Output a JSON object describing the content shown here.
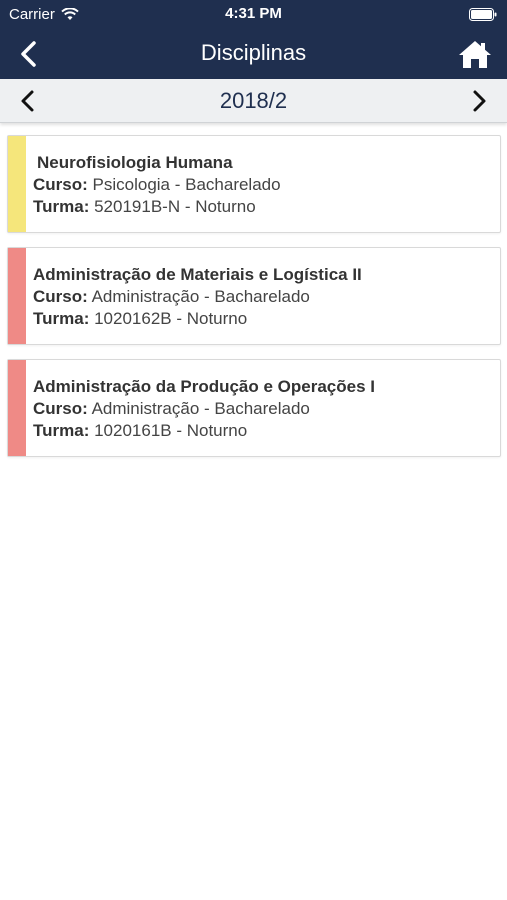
{
  "status": {
    "carrier": "Carrier",
    "time": "4:31 PM"
  },
  "nav": {
    "title": "Disciplinas"
  },
  "semester": {
    "label": "2018/2"
  },
  "courses": [
    {
      "name": "Neurofisiologia Humana",
      "curso_label": "Curso:",
      "curso": "Psicologia - Bacharelado",
      "turma_label": "Turma:",
      "turma": "520191B-N - Noturno",
      "color": "#f5e67b"
    },
    {
      "name": "Administração de Materiais e Logística II",
      "curso_label": "Curso:",
      "curso": "Administração - Bacharelado",
      "turma_label": "Turma:",
      "turma": "1020162B - Noturno",
      "color": "#ef8a86"
    },
    {
      "name": "Administração da Produção e Operações I",
      "curso_label": "Curso:",
      "curso": "Administração - Bacharelado",
      "turma_label": "Turma:",
      "turma": "1020161B - Noturno",
      "color": "#ef8a86"
    }
  ],
  "colors": {
    "header_bg": "#1f2f4f",
    "semester_bg": "#eef0f2"
  }
}
